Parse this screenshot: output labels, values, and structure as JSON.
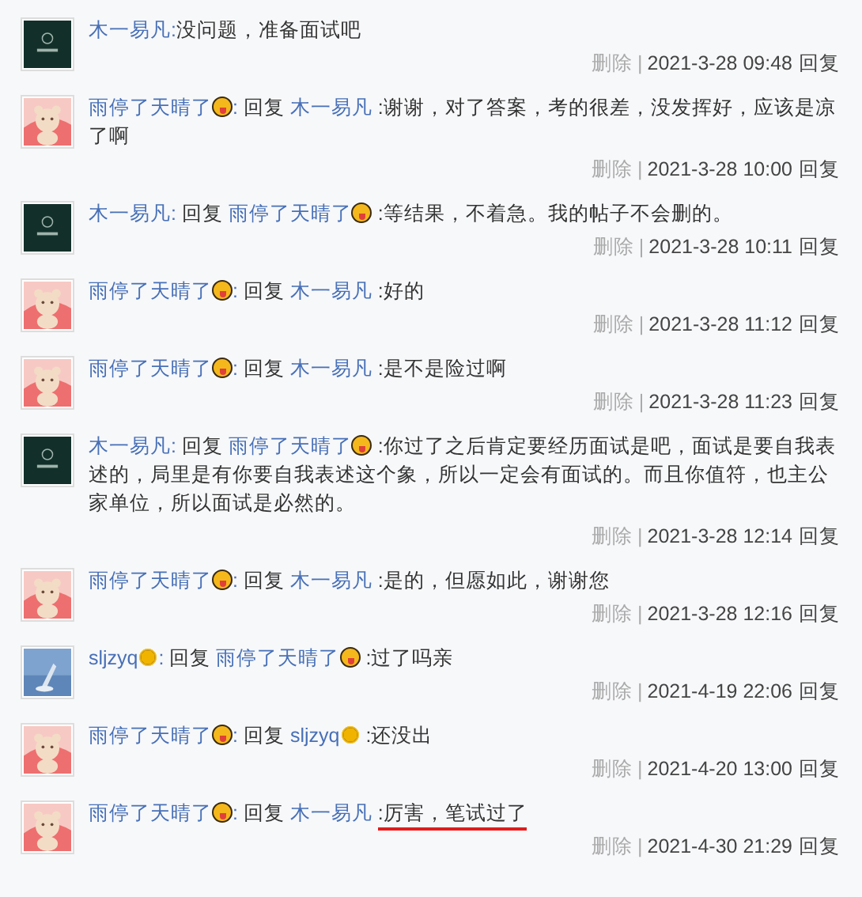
{
  "comments": [
    {
      "avatar": {
        "kind": "logo"
      },
      "author": {
        "name": "木一易凡"
      },
      "suffix": ":",
      "text": "没问题，准备面试吧",
      "underlined": false,
      "meta": {
        "delete": "删除",
        "separator": "|",
        "time": "2021-3-28 09:48",
        "reply": "回复"
      }
    },
    {
      "avatar": {
        "kind": "bear"
      },
      "author": {
        "name": "雨停了天晴了",
        "badge": {
          "kind": "tongue"
        }
      },
      "suffix": ":",
      "reply_word": "回复",
      "reply_to": {
        "name": "木一易凡"
      },
      "text": ":谢谢，对了答案，考的很差，没发挥好，应该是凉了啊",
      "underlined": false,
      "meta": {
        "delete": "删除",
        "separator": "|",
        "time": "2021-3-28 10:00",
        "reply": "回复"
      }
    },
    {
      "avatar": {
        "kind": "logo"
      },
      "author": {
        "name": "木一易凡"
      },
      "suffix": ":",
      "reply_word": "回复",
      "reply_to": {
        "name": "雨停了天晴了",
        "badge": {
          "kind": "tongue"
        }
      },
      "text": ":等结果，不着急。我的帖子不会删的。",
      "underlined": false,
      "meta": {
        "delete": "删除",
        "separator": "|",
        "time": "2021-3-28 10:11",
        "reply": "回复"
      }
    },
    {
      "avatar": {
        "kind": "bear"
      },
      "author": {
        "name": "雨停了天晴了",
        "badge": {
          "kind": "tongue"
        }
      },
      "suffix": ":",
      "reply_word": "回复",
      "reply_to": {
        "name": "木一易凡"
      },
      "text": ":好的",
      "underlined": false,
      "meta": {
        "delete": "删除",
        "separator": "|",
        "time": "2021-3-28 11:12",
        "reply": "回复"
      }
    },
    {
      "avatar": {
        "kind": "bear"
      },
      "author": {
        "name": "雨停了天晴了",
        "badge": {
          "kind": "tongue"
        }
      },
      "suffix": ":",
      "reply_word": "回复",
      "reply_to": {
        "name": "木一易凡"
      },
      "text": ":是不是险过啊",
      "underlined": false,
      "meta": {
        "delete": "删除",
        "separator": "|",
        "time": "2021-3-28 11:23",
        "reply": "回复"
      }
    },
    {
      "avatar": {
        "kind": "logo"
      },
      "author": {
        "name": "木一易凡"
      },
      "suffix": ":",
      "reply_word": "回复",
      "reply_to": {
        "name": "雨停了天晴了",
        "badge": {
          "kind": "tongue"
        }
      },
      "text": ":你过了之后肯定要经历面试是吧，面试是要自我表述的，局里是有你要自我表述这个象，所以一定会有面试的。而且你值符，也主公家单位，所以面试是必然的。",
      "underlined": false,
      "meta": {
        "delete": "删除",
        "separator": "|",
        "time": "2021-3-28 12:14",
        "reply": "回复"
      }
    },
    {
      "avatar": {
        "kind": "bear"
      },
      "author": {
        "name": "雨停了天晴了",
        "badge": {
          "kind": "tongue"
        }
      },
      "suffix": ":",
      "reply_word": "回复",
      "reply_to": {
        "name": "木一易凡"
      },
      "text": ":是的，但愿如此，谢谢您",
      "underlined": false,
      "meta": {
        "delete": "删除",
        "separator": "|",
        "time": "2021-3-28 12:16",
        "reply": "回复"
      }
    },
    {
      "avatar": {
        "kind": "sea"
      },
      "author": {
        "name": "sljzyq",
        "badge": {
          "kind": "sun"
        }
      },
      "suffix": ":",
      "reply_word": "回复",
      "reply_to": {
        "name": "雨停了天晴了",
        "badge": {
          "kind": "tongue"
        }
      },
      "text": ":过了吗亲",
      "underlined": false,
      "meta": {
        "delete": "删除",
        "separator": "|",
        "time": "2021-4-19 22:06",
        "reply": "回复"
      }
    },
    {
      "avatar": {
        "kind": "bear"
      },
      "author": {
        "name": "雨停了天晴了",
        "badge": {
          "kind": "tongue"
        }
      },
      "suffix": ":",
      "reply_word": "回复",
      "reply_to": {
        "name": "sljzyq",
        "badge": {
          "kind": "sun"
        }
      },
      "text": ":还没出",
      "underlined": false,
      "meta": {
        "delete": "删除",
        "separator": "|",
        "time": "2021-4-20 13:00",
        "reply": "回复"
      }
    },
    {
      "avatar": {
        "kind": "bear"
      },
      "author": {
        "name": "雨停了天晴了",
        "badge": {
          "kind": "tongue"
        }
      },
      "suffix": ":",
      "reply_word": "回复",
      "reply_to": {
        "name": "木一易凡"
      },
      "text": ":厉害，笔试过了",
      "underlined": true,
      "meta": {
        "delete": "删除",
        "separator": "|",
        "time": "2021-4-30 21:29",
        "reply": "回复"
      }
    }
  ]
}
